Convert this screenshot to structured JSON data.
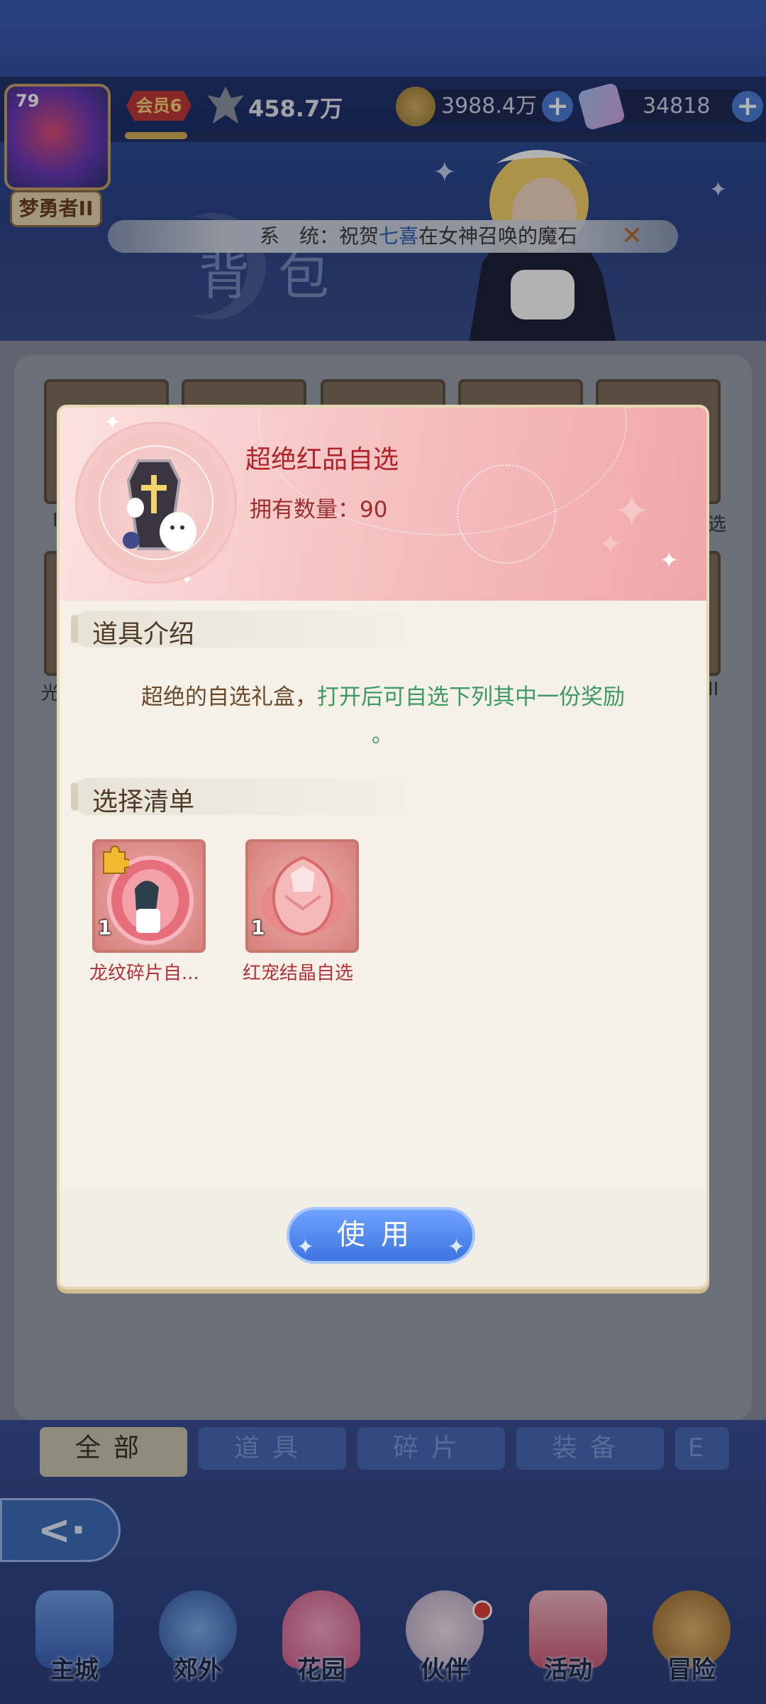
{
  "header": {
    "player_level": "79",
    "rank_title": "梦勇者II",
    "vip_label": "会员6",
    "power": "458.7万",
    "exp_progress": 0.1,
    "gold": "3988.4万",
    "gems": "34818",
    "plus_symbol": "+"
  },
  "background": {
    "page_title": "背包"
  },
  "ticker": {
    "prefix": "系　统：祝贺",
    "name": "七喜",
    "suffix": "在女神召唤的魔石",
    "close_symbol": "✕"
  },
  "inventory_partial_labels": {
    "left_1": "I",
    "left_2": "光",
    "right_1": "选",
    "right_2": "II"
  },
  "modal": {
    "item_name": "超绝红品自选",
    "count_label": "拥有数量：",
    "count_value": "90",
    "intro_title": "道具介绍",
    "intro_text_plain": "超绝的自选礼盒，",
    "intro_text_green": "打开后可自选下列其中一份奖励",
    "intro_text_end": "。",
    "list_title": "选择清单",
    "rewards": [
      {
        "name": "龙纹碎片自...",
        "qty": "1",
        "icon": "dragon-fragment-icon"
      },
      {
        "name": "红宠结晶自选",
        "qty": "1",
        "icon": "red-pet-crystal-icon"
      }
    ],
    "use_button": "使用"
  },
  "tabs": [
    {
      "label": "全部",
      "active": true
    },
    {
      "label": "道具",
      "active": false
    },
    {
      "label": "碎片",
      "active": false
    },
    {
      "label": "装备",
      "active": false
    },
    {
      "label": "E",
      "active": false
    }
  ],
  "bottom_nav": [
    {
      "label": "主城",
      "icon": "castle-icon"
    },
    {
      "label": "郊外",
      "icon": "portal-icon"
    },
    {
      "label": "花园",
      "icon": "heart-garden-icon"
    },
    {
      "label": "伙伴",
      "icon": "partner-icon"
    },
    {
      "label": "活动",
      "icon": "gift-icon"
    },
    {
      "label": "冒险",
      "icon": "sword-icon"
    }
  ],
  "colors": {
    "accent_blue": "#3e74e0",
    "title_red": "#b0232a",
    "desc_green": "#3d9a62"
  }
}
